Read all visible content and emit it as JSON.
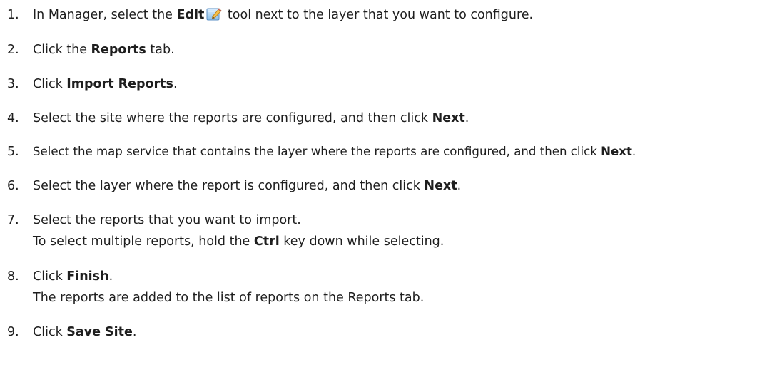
{
  "steps": [
    {
      "number": "1.",
      "pre": "In Manager, select the ",
      "bold": "Edit",
      "icon": "edit-pencil-icon",
      "post": " tool next to the layer that you want to configure."
    },
    {
      "number": "2.",
      "pre": "Click the ",
      "bold": "Reports",
      "post": " tab."
    },
    {
      "number": "3.",
      "pre": "Click ",
      "bold": "Import Reports",
      "post": "."
    },
    {
      "number": "4.",
      "pre": "Select the site where the reports are configured, and then click ",
      "bold": "Next",
      "post": "."
    },
    {
      "number": "5.",
      "pre": "Select the map service that contains the layer where the reports are configured, and then click ",
      "bold": "Next",
      "post": "."
    },
    {
      "number": "6.",
      "pre": "Select the layer where the report is configured, and then click ",
      "bold": "Next",
      "post": "."
    },
    {
      "number": "7.",
      "text": "Select the reports that you want to import.",
      "sub_pre": "To select multiple reports, hold the ",
      "sub_bold": "Ctrl",
      "sub_post": " key down while selecting."
    },
    {
      "number": "8.",
      "pre": "Click ",
      "bold": "Finish",
      "post": ".",
      "sub_text": "The reports are added to the list of reports on the Reports tab."
    },
    {
      "number": "9.",
      "pre": "Click ",
      "bold": "Save Site",
      "post": "."
    }
  ]
}
